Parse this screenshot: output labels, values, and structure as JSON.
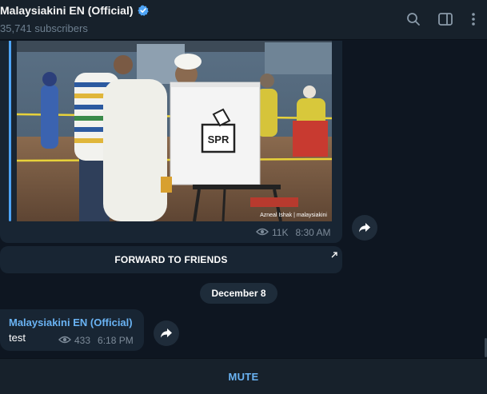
{
  "header": {
    "title": "Malaysiakini EN (Official)",
    "subtitle": "35,741 subscribers",
    "icons": [
      "search-icon",
      "sidebar-toggle-icon",
      "more-vertical-icon"
    ]
  },
  "messages": [
    {
      "type": "photo",
      "photo_credit": "Azneal Ishak | malaysiakini",
      "booth_label": "SPR",
      "views": "11K",
      "time": "8:30 AM",
      "forward_label": "FORWARD TO FRIENDS"
    },
    {
      "type": "text",
      "author": "Malaysiakini EN (Official)",
      "text": "test",
      "views": "433",
      "time": "6:18 PM"
    }
  ],
  "date_separator": "December 8",
  "footer": {
    "mute_label": "MUTE"
  },
  "colors": {
    "background": "#0e1621",
    "header": "#17212b",
    "bubble": "#182533",
    "accent": "#4ea4f6",
    "link": "#6ab3f3",
    "muted_text": "#7d8b99"
  }
}
